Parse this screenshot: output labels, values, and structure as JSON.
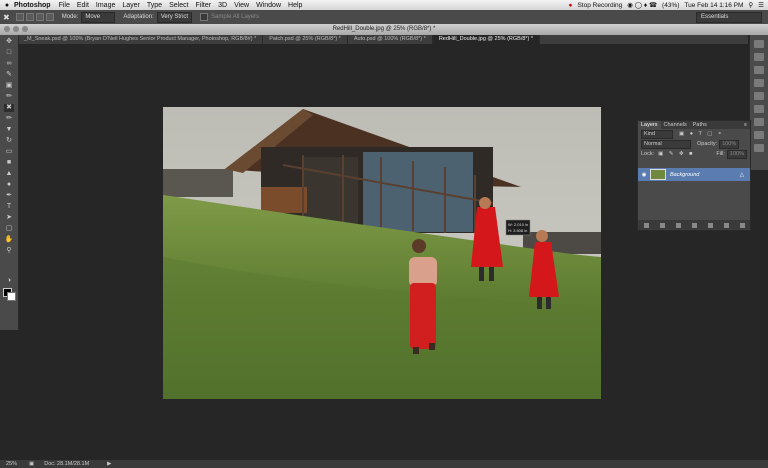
{
  "menubar": {
    "apple": "",
    "app": "Photoshop",
    "menus": [
      "File",
      "Edit",
      "Image",
      "Layer",
      "Type",
      "Select",
      "Filter",
      "3D",
      "View",
      "Window",
      "Help"
    ],
    "recording": "Stop Recording",
    "battery": "(43%)",
    "datetime": "Tue Feb 14  1:16 PM"
  },
  "options": {
    "mode_label": "Mode:",
    "mode_value": "Move",
    "adaptation_label": "Adaptation:",
    "adaptation_value": "Very Strict",
    "sample_label": "Sample All Layers",
    "workspace": "Essentials"
  },
  "document": {
    "title": "RedHill_Double.jpg @ 25% (RGB/8*) *",
    "tabs": [
      "_M_Sneak.psd @ 100% (Bryan O'Neil Hughes Senior Product Manager, Photoshop, RGB/8#) *",
      "Patch.psd @ 25% (RGB/8*) *",
      "Auto.psd @ 100% (RGB/8*) *",
      "RedHill_Double.jpg @ 25% (RGB/8*) *"
    ]
  },
  "info": {
    "w": "W: 2.010 in",
    "h": "H: 3.508 in"
  },
  "layers": {
    "tabs": [
      "Layers",
      "Channels",
      "Paths"
    ],
    "kind": "Kind",
    "blend": "Normal",
    "opacity_label": "Opacity:",
    "opacity_value": "100%",
    "lock_label": "Lock:",
    "fill_label": "Fill:",
    "fill_value": "100%",
    "layer_name": "Background"
  },
  "status": {
    "zoom": "25%",
    "doc": "Doc: 28.1M/28.1M"
  },
  "colors": {
    "foreground": "#000000",
    "background": "#ffffff",
    "selection": "#5a7cb0"
  }
}
